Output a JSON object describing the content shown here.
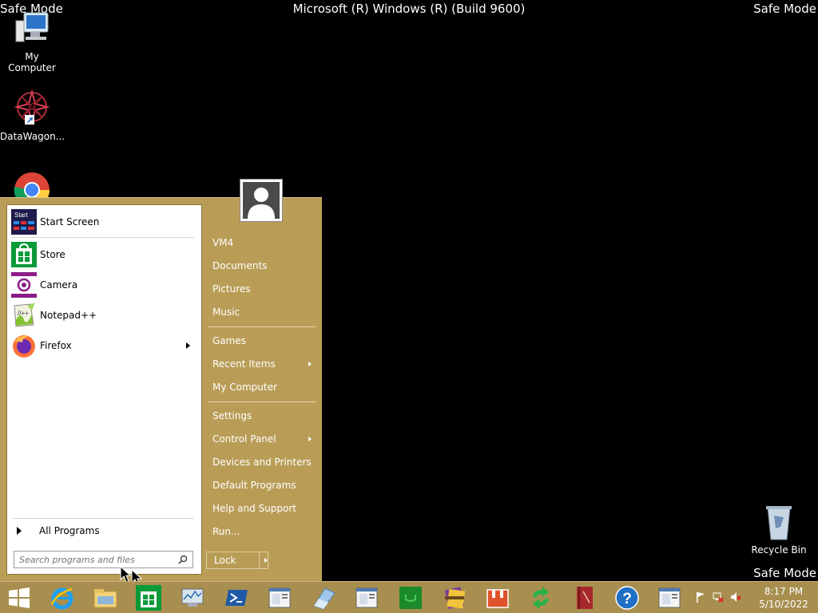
{
  "overlay": {
    "safe_mode_top_left": "Safe Mode",
    "safe_mode_top_right": "Safe Mode",
    "safe_mode_bottom_right": "Safe Mode",
    "build_banner": "Microsoft (R) Windows (R) (Build 9600)"
  },
  "desktop_icons": [
    {
      "label": "My Computer",
      "icon": "computer-icon"
    },
    {
      "label": "DataWagon...",
      "icon": "datawagon-icon"
    },
    {
      "label": "",
      "icon": "chrome-icon"
    },
    {
      "label": "Recycle Bin",
      "icon": "recycle-bin-icon"
    }
  ],
  "start_menu": {
    "pinned": [
      {
        "label": "Start Screen",
        "icon": "start-screen-icon"
      },
      {
        "label": "Store",
        "icon": "store-icon"
      },
      {
        "label": "Camera",
        "icon": "camera-icon"
      },
      {
        "label": "Notepad++",
        "icon": "notepadpp-icon"
      },
      {
        "label": "Firefox",
        "icon": "firefox-icon",
        "has_submenu": true
      }
    ],
    "start_tile_text": "Start",
    "all_programs": "All Programs",
    "search_placeholder": "Search programs and files",
    "right": [
      {
        "label": "VM4"
      },
      {
        "label": "Documents"
      },
      {
        "label": "Pictures"
      },
      {
        "label": "Music"
      },
      {
        "label": "Games"
      },
      {
        "label": "Recent Items",
        "has_submenu": true
      },
      {
        "label": "My Computer"
      },
      {
        "label": "Settings"
      },
      {
        "label": "Control Panel",
        "has_submenu": true
      },
      {
        "label": "Devices and Printers"
      },
      {
        "label": "Default Programs"
      },
      {
        "label": "Help and Support"
      },
      {
        "label": "Run..."
      }
    ],
    "lock_button": "Lock",
    "notepad_tile_text": "//++"
  },
  "taskbar": {
    "items": [
      "windows-start-icon",
      "ie-icon",
      "file-explorer-icon",
      "store-icon",
      "resource-monitor-icon",
      "powershell-icon",
      "window-app-icon",
      "eraser-app-icon",
      "window-app-icon",
      "green-app-icon",
      "winrar-icon",
      "toolbox-icon",
      "sync-icon",
      "book-icon",
      "help-icon",
      "window-app-icon"
    ],
    "help_text": "?",
    "clock_time": "8:17 PM",
    "clock_date": "5/10/2022"
  },
  "colors": {
    "start_menu_bg": "#b99d57",
    "taskbar_bg": "#a88f4f",
    "desktop_bg": "#000000"
  }
}
